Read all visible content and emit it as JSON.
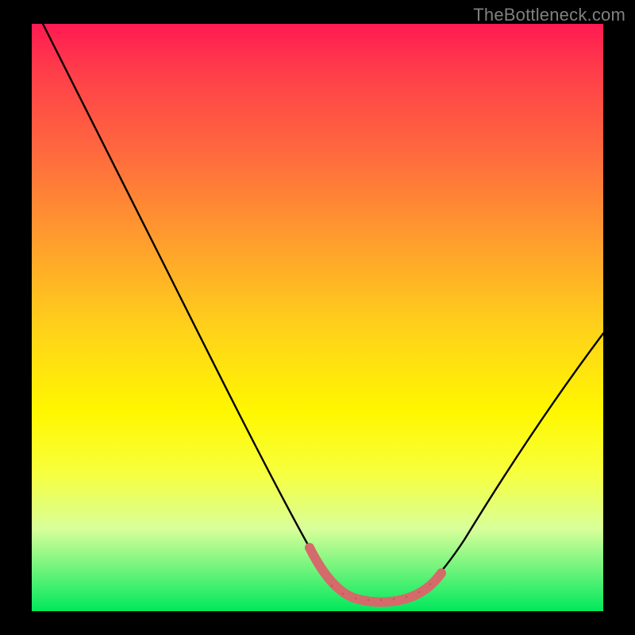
{
  "watermark": "TheBottleneck.com",
  "chart_data": {
    "type": "line",
    "title": "",
    "xlabel": "",
    "ylabel": "",
    "xlim": [
      0,
      100
    ],
    "ylim": [
      0,
      100
    ],
    "x_axis_visible": false,
    "y_axis_visible": false,
    "background_gradient": [
      "#ff1a52",
      "#ff6a3e",
      "#ffd21a",
      "#fff700",
      "#00e85c"
    ],
    "series": [
      {
        "name": "bottleneck-curve",
        "color": "#000000",
        "x": [
          2,
          10,
          20,
          30,
          40,
          48,
          52,
          56,
          60,
          64,
          70,
          78,
          88,
          100
        ],
        "y": [
          100,
          86,
          69,
          52,
          34,
          16,
          6,
          2,
          2,
          2,
          6,
          18,
          34,
          53
        ]
      },
      {
        "name": "optimal-range-marker",
        "color": "#d46a6a",
        "x": [
          48,
          52,
          56,
          60,
          64,
          68
        ],
        "y": [
          13,
          4,
          2,
          2,
          2,
          5
        ]
      }
    ],
    "notes": "Axes unlabeled in source image; x and y are normalized 0-100. y=0 is the green bottom (optimal), y=100 is the red top (severe bottleneck). Curve left branch starts near top-left and descends steeply; flat minimum around x=54-66; right branch climbs to ~y=53 at right edge."
  }
}
